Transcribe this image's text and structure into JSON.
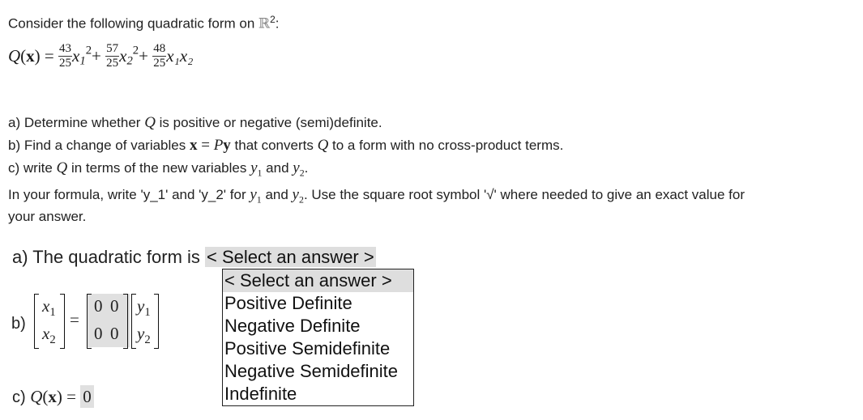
{
  "intro": {
    "text": "Consider the following quadratic form on ",
    "space_symbol": "ℝ",
    "space_exp": "2",
    "colon": ":"
  },
  "formula": {
    "lhs": "Q(x) =",
    "terms": [
      {
        "num": "43",
        "den": "25",
        "var": "x",
        "sub": "1",
        "exp": "2",
        "op": "+"
      },
      {
        "num": "57",
        "den": "25",
        "var": "x",
        "sub": "2",
        "exp": "2",
        "op": "+"
      },
      {
        "num": "48",
        "den": "25",
        "var": "x₁x₂"
      }
    ]
  },
  "questions": {
    "a": {
      "pre": "a) Determine whether ",
      "var": "Q",
      "post": " is positive or negative (semi)definite."
    },
    "b": {
      "pre": "b) Find a change of variables ",
      "eq": "x = Py",
      "mid": " that converts ",
      "var": "Q",
      "post": " to a form with no cross-product terms."
    },
    "c": {
      "pre": "c) write ",
      "var": "Q",
      "mid": " in terms of the new variables ",
      "y1": "y",
      "y1_sub": "1",
      "and": " and ",
      "y2": "y",
      "y2_sub": "2",
      "post": "."
    }
  },
  "instructions": {
    "line1_pre": "In your formula, write 'y_1' and 'y_2' for ",
    "y1": "y",
    "y1_sub": "1",
    "and": " and ",
    "y2": "y",
    "y2_sub": "2",
    "line1_post": ". Use the square root symbol '√' where needed to give an exact value for",
    "line2": "your answer."
  },
  "part_a": {
    "label": "a) The quadratic form is ",
    "selected": "< Select an answer >",
    "options": [
      "< Select an answer >",
      "Positive Definite",
      "Negative Definite",
      "Positive Semidefinite",
      "Negative Semidefinite",
      "Indefinite"
    ],
    "highlighted_index": 0
  },
  "part_b": {
    "label": "b)",
    "lhs_vector": [
      [
        "x",
        "1"
      ],
      [
        "x",
        "2"
      ]
    ],
    "equals": "=",
    "matrix": [
      [
        "0",
        "0"
      ],
      [
        "0",
        "0"
      ]
    ],
    "rhs_vector": [
      [
        "y",
        "1"
      ],
      [
        "y",
        "2"
      ]
    ]
  },
  "part_c": {
    "label": "c)",
    "lhs": "Q(x) =",
    "value": "0"
  }
}
